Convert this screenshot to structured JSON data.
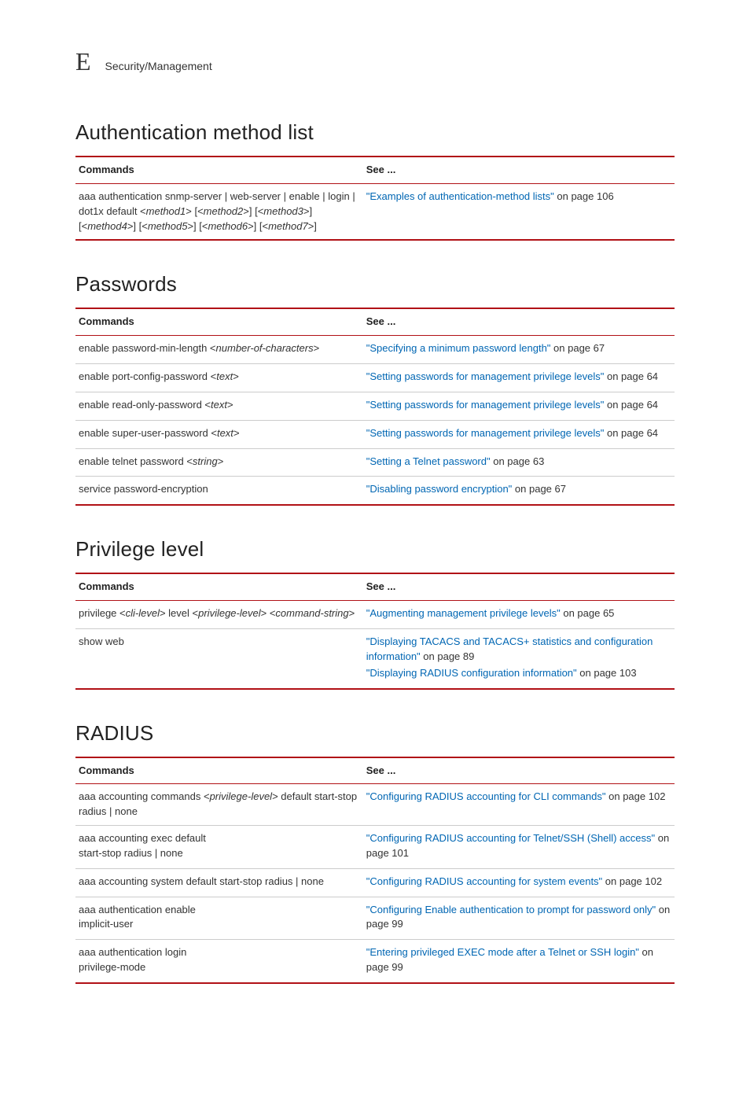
{
  "header": {
    "appendix": "E",
    "breadcrumb": "Security/Management"
  },
  "table_headers": {
    "commands": "Commands",
    "see": "See ..."
  },
  "sections": [
    {
      "title": "Authentication method list",
      "rows": [
        {
          "cmd": [
            {
              "t": "aaa authentication snmp-server | web-server | enable | login | dot1x  default <"
            },
            {
              "t": "method1",
              "i": true
            },
            {
              "t": "> [<"
            },
            {
              "t": "method2",
              "i": true
            },
            {
              "t": ">] [<"
            },
            {
              "t": "method3",
              "i": true
            },
            {
              "t": ">] [<"
            },
            {
              "t": "method4",
              "i": true
            },
            {
              "t": ">] [<"
            },
            {
              "t": "method5",
              "i": true
            },
            {
              "t": ">] [<"
            },
            {
              "t": "method6",
              "i": true
            },
            {
              "t": ">] [<"
            },
            {
              "t": "method7",
              "i": true
            },
            {
              "t": ">]"
            }
          ],
          "see": [
            {
              "link": "\"Examples of authentication-method lists\"",
              "suffix": " on page 106"
            }
          ]
        }
      ]
    },
    {
      "title": "Passwords",
      "rows": [
        {
          "cmd": [
            {
              "t": "enable password-min-length <"
            },
            {
              "t": "number-of-characters",
              "i": true
            },
            {
              "t": ">"
            }
          ],
          "see": [
            {
              "link": "\"Specifying a minimum password length\"",
              "suffix": " on page 67"
            }
          ]
        },
        {
          "cmd": [
            {
              "t": "enable port-config-password <"
            },
            {
              "t": "text",
              "i": true
            },
            {
              "t": ">"
            }
          ],
          "see": [
            {
              "link": "\"Setting passwords for management privilege levels\"",
              "suffix": " on page 64"
            }
          ]
        },
        {
          "cmd": [
            {
              "t": "enable read-only-password <"
            },
            {
              "t": "text",
              "i": true
            },
            {
              "t": ">"
            }
          ],
          "see": [
            {
              "link": "\"Setting passwords for management privilege levels\"",
              "suffix": " on page 64"
            }
          ]
        },
        {
          "cmd": [
            {
              "t": "enable super-user-password <"
            },
            {
              "t": "text",
              "i": true
            },
            {
              "t": ">"
            }
          ],
          "see": [
            {
              "link": "\"Setting passwords for management privilege levels\"",
              "suffix": " on page 64"
            }
          ]
        },
        {
          "cmd": [
            {
              "t": "enable telnet password <"
            },
            {
              "t": "string",
              "i": true
            },
            {
              "t": ">"
            }
          ],
          "see": [
            {
              "link": "\"Setting a Telnet password\"",
              "suffix": " on page 63"
            }
          ]
        },
        {
          "cmd": [
            {
              "t": "service password-encryption"
            }
          ],
          "see": [
            {
              "link": "\"Disabling password encryption\"",
              "suffix": " on page 67"
            }
          ]
        }
      ]
    },
    {
      "title": "Privilege level",
      "rows": [
        {
          "cmd": [
            {
              "t": "privilege <"
            },
            {
              "t": "cli-level",
              "i": true
            },
            {
              "t": "> level <"
            },
            {
              "t": "privilege-level",
              "i": true
            },
            {
              "t": "> <"
            },
            {
              "t": "command-string",
              "i": true
            },
            {
              "t": ">"
            }
          ],
          "see": [
            {
              "link": "\"Augmenting management privilege levels\"",
              "suffix": " on page 65"
            }
          ]
        },
        {
          "cmd": [
            {
              "t": "show web"
            }
          ],
          "see": [
            {
              "link": "\"Displaying TACACS and TACACS+ statistics and configuration information\"",
              "suffix": " on page 89"
            },
            {
              "link": "\"Displaying RADIUS configuration information\"",
              "suffix": " on page 103"
            }
          ]
        }
      ]
    },
    {
      "title": "RADIUS",
      "rows": [
        {
          "cmd": [
            {
              "t": "aaa accounting commands <"
            },
            {
              "t": "privilege-level",
              "i": true
            },
            {
              "t": "> default start-stop radius | none"
            }
          ],
          "see": [
            {
              "link": "\"Configuring RADIUS accounting for CLI commands\"",
              "suffix": " on page 102"
            }
          ]
        },
        {
          "cmd": [
            {
              "t": "aaa accounting exec default"
            },
            {
              "br": true
            },
            {
              "t": "start-stop radius | none"
            }
          ],
          "see": [
            {
              "link": "\"Configuring RADIUS accounting for Telnet/SSH (Shell) access\"",
              "suffix": " on page 101"
            }
          ]
        },
        {
          "cmd": [
            {
              "t": "aaa accounting system default start-stop radius | none"
            }
          ],
          "see": [
            {
              "link": "\"Configuring RADIUS accounting for system events\"",
              "suffix": " on page 102"
            }
          ]
        },
        {
          "cmd": [
            {
              "t": "aaa authentication enable"
            },
            {
              "br": true
            },
            {
              "t": "implicit-user"
            }
          ],
          "see": [
            {
              "link": "\"Configuring Enable authentication to prompt for password only\"",
              "suffix": " on page 99"
            }
          ]
        },
        {
          "cmd": [
            {
              "t": "aaa authentication login"
            },
            {
              "br": true
            },
            {
              "t": "privilege-mode"
            }
          ],
          "see": [
            {
              "link": "\"Entering privileged EXEC mode after a Telnet or SSH login\"",
              "suffix": " on page 99"
            }
          ]
        }
      ]
    }
  ]
}
